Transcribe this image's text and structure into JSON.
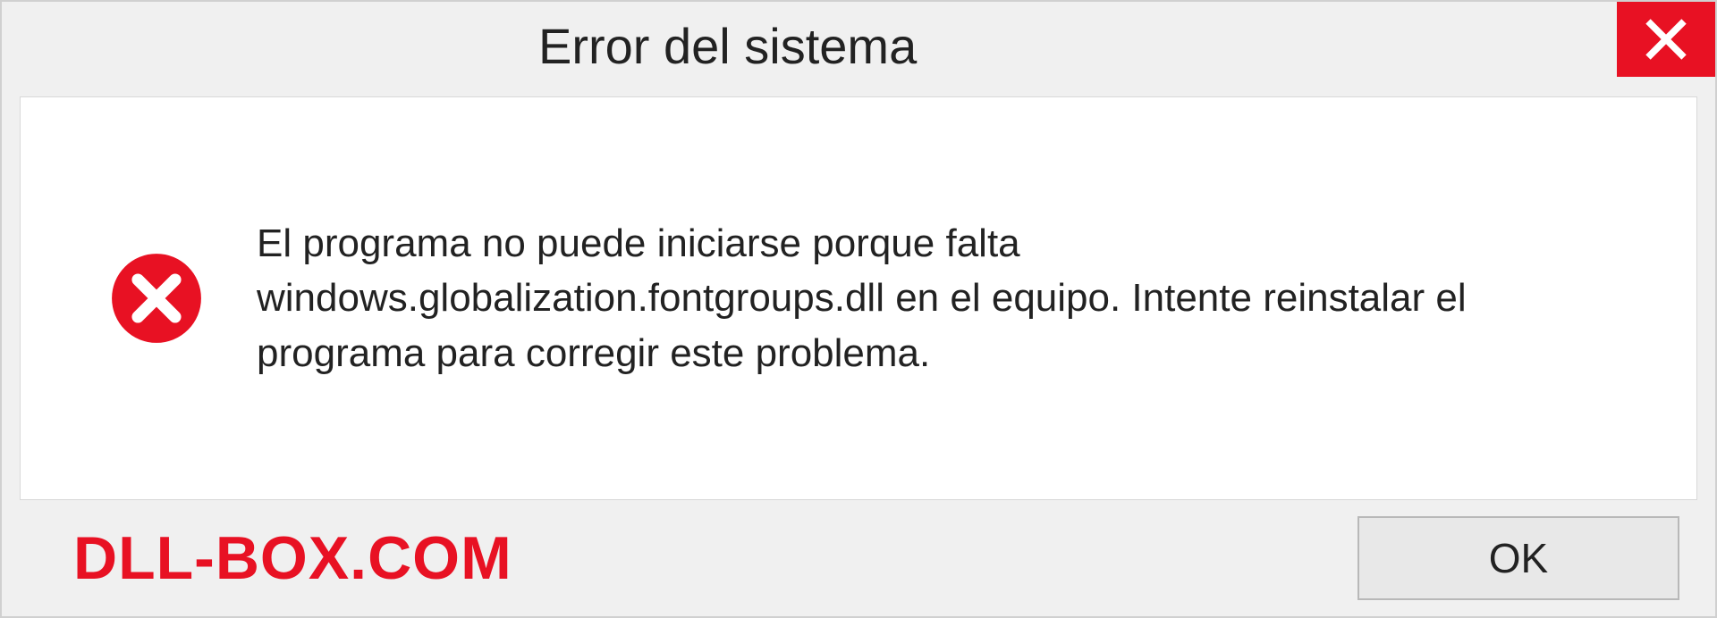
{
  "dialog": {
    "title": "Error del sistema",
    "message": "El programa no puede iniciarse porque falta windows.globalization.fontgroups.dll en el equipo. Intente reinstalar el programa para corregir este problema.",
    "ok_label": "OK"
  },
  "watermark": "DLL-BOX.COM",
  "colors": {
    "close_red": "#e81123",
    "error_red": "#e81123"
  }
}
